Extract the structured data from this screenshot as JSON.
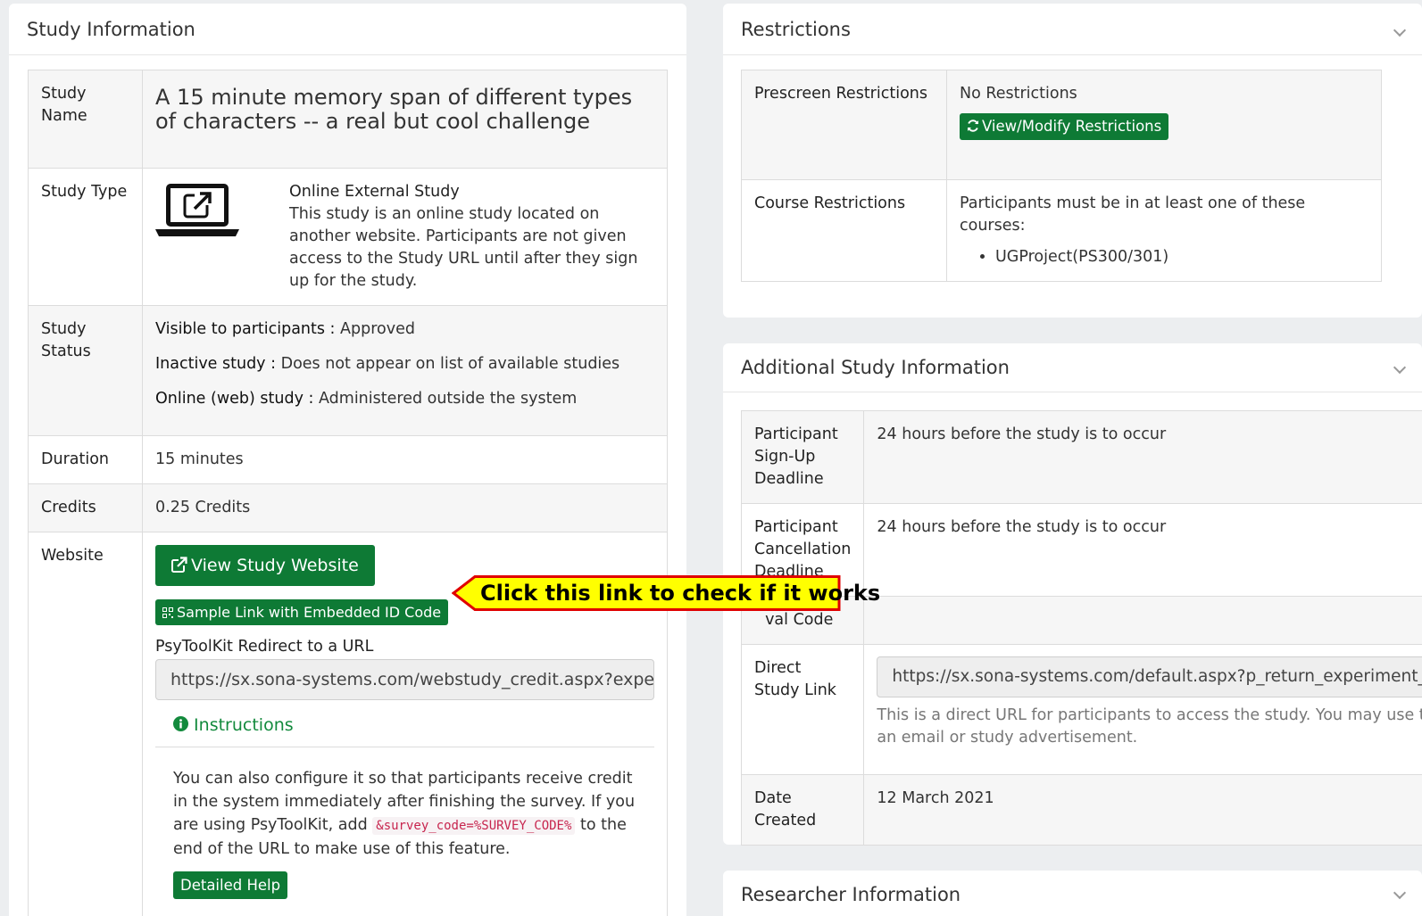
{
  "left_panel": {
    "title": "Study Information",
    "rows": {
      "name_label": "Study Name",
      "name_value": "A 15 minute memory span of different types of characters -- a real but cool challenge",
      "type_label": "Study Type",
      "type_title": "Online External Study",
      "type_desc": "This study is an online study located on another website. Participants are not given access to the Study URL until after they sign up for the study.",
      "status_label": "Study Status",
      "status_items": [
        {
          "key": "Visible to participants :",
          "value": "Approved"
        },
        {
          "key": "Inactive study :",
          "value": "Does not appear on list of available studies"
        },
        {
          "key": "Online (web) study :",
          "value": "Administered outside the system"
        }
      ],
      "duration_label": "Duration",
      "duration_value": "15 minutes",
      "credits_label": "Credits",
      "credits_value": "0.25 Credits",
      "website_label": "Website"
    },
    "website": {
      "view_button": "View Study Website",
      "sample_button": "Sample Link with Embedded ID Code",
      "redirect_label": "PsyToolKit Redirect to a URL",
      "redirect_url": "https://sx.sona-systems.com/webstudy_credit.aspx?experiment_id=",
      "instructions_label": "Instructions",
      "instructions_text_1": "You can also configure it so that participants receive credit in the system immediately after finishing the survey. If you are using PsyToolKit, add",
      "instructions_code": "&survey_code=%SURVEY_CODE%",
      "instructions_text_2": "to the end of the URL to make use of this feature.",
      "help_button": "Detailed Help"
    }
  },
  "callout": {
    "text": "Click this link to check if it works",
    "fill": "#ffff00",
    "border": "#e00000"
  },
  "restrictions_panel": {
    "title": "Restrictions",
    "prescreen_label": "Prescreen Restrictions",
    "prescreen_value": "No Restrictions",
    "modify_button": "View/Modify Restrictions",
    "course_label": "Course Restrictions",
    "course_value": "Participants must be in at least one of these courses:",
    "courses": [
      "UGProject(PS300/301)"
    ]
  },
  "additional_panel": {
    "title": "Additional Study Information",
    "signup_label": "Participant Sign-Up Deadline",
    "signup_value": "24 hours before the study is to occur",
    "cancel_label": "Participant Cancellation Deadline",
    "cancel_value": "24 hours before the study is to occur",
    "approval_label": "val Code",
    "direct_label": "Direct Study Link",
    "direct_url": "https://sx.sona-systems.com/default.aspx?p_return_experiment_id=",
    "direct_help": "This is a direct URL for participants to access the study. You may use this in an email or study advertisement.",
    "created_label": "Date Created",
    "created_value": "12 March 2021"
  },
  "researcher_panel": {
    "title": "Researcher Information"
  },
  "colors": {
    "brand_green": "#0e7a35",
    "link_green": "#138a3d"
  }
}
